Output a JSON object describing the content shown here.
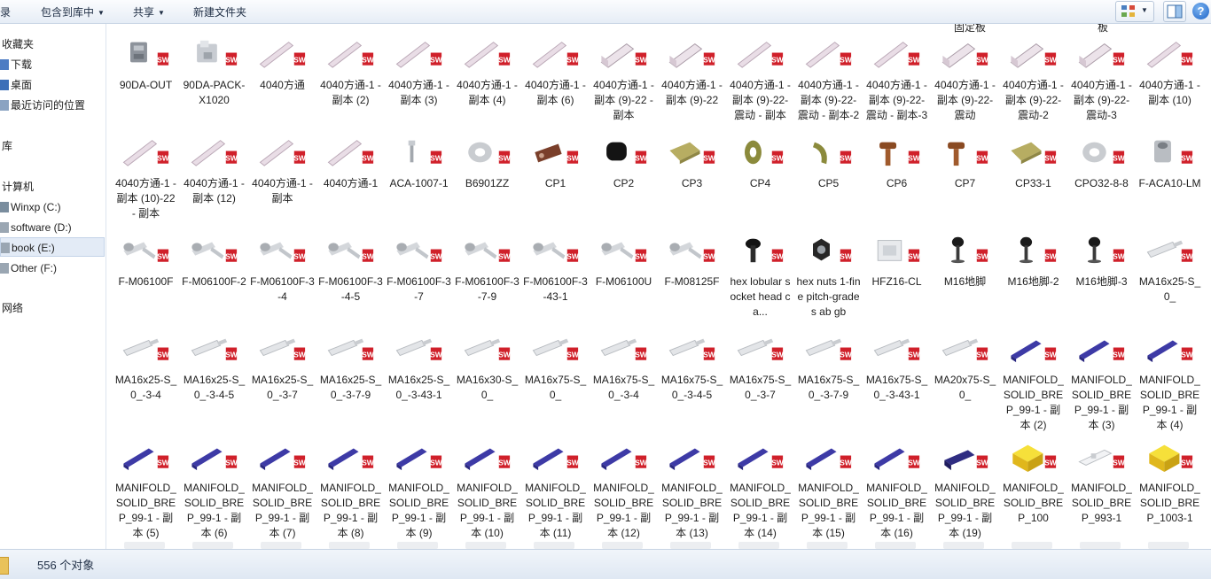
{
  "toolbar": {
    "partial_left": "录",
    "include_library": "包含到库中",
    "share": "共享",
    "new_folder": "新建文件夹"
  },
  "sidebar": {
    "favorites": "收藏夹",
    "downloads": "下载",
    "desktop": "桌面",
    "recent": "最近访问的位置",
    "libraries": "库",
    "computer": "计算机",
    "drive_c": "Winxp (C:)",
    "drive_d": "software (D:)",
    "drive_e": "book (E:)",
    "drive_f": "Other (F:)",
    "network": "网络"
  },
  "partial_top_labels": [
    "固定板",
    "板"
  ],
  "rows": [
    [
      {
        "name": "90DA-OUT",
        "icon": "connector-gray"
      },
      {
        "name": "90DA-PACK-X1020",
        "icon": "connector-light"
      },
      {
        "name": "4040方通",
        "icon": "profile-rod"
      },
      {
        "name": "4040方通-1 - 副本 (2)",
        "icon": "profile-rod"
      },
      {
        "name": "4040方通-1 - 副本 (3)",
        "icon": "profile-rod"
      },
      {
        "name": "4040方通-1 - 副本 (4)",
        "icon": "profile-rod"
      },
      {
        "name": "4040方通-1 - 副本 (6)",
        "icon": "profile-rod"
      },
      {
        "name": "4040方通-1 - 副本 (9)-22 - 副本",
        "icon": "profile-short"
      },
      {
        "name": "4040方通-1 - 副本 (9)-22",
        "icon": "profile-short"
      },
      {
        "name": "4040方通-1 - 副本 (9)-22-震动 - 副本",
        "icon": "profile-rod"
      },
      {
        "name": "4040方通-1 - 副本 (9)-22-震动 - 副本-2",
        "icon": "profile-rod"
      },
      {
        "name": "4040方通-1 - 副本 (9)-22-震动 - 副本-3",
        "icon": "profile-rod"
      },
      {
        "name": "4040方通-1 - 副本 (9)-22-震动",
        "icon": "profile-short"
      },
      {
        "name": "4040方通-1 - 副本 (9)-22-震动-2",
        "icon": "profile-short"
      },
      {
        "name": "4040方通-1 - 副本 (9)-22-震动-3",
        "icon": "profile-short"
      },
      {
        "name": "4040方通-1 - 副本 (10)",
        "icon": "profile-rod"
      }
    ],
    [
      {
        "name": "4040方通-1 - 副本 (10)-22 - 副本",
        "icon": "profile-rod"
      },
      {
        "name": "4040方通-1 - 副本 (12)",
        "icon": "profile-rod"
      },
      {
        "name": "4040方通-1 - 副本",
        "icon": "profile-rod"
      },
      {
        "name": "4040方通-1",
        "icon": "profile-rod"
      },
      {
        "name": "ACA-1007-1",
        "icon": "pin-small"
      },
      {
        "name": "B6901ZZ",
        "icon": "bearing"
      },
      {
        "name": "CP1",
        "icon": "clamp-brown"
      },
      {
        "name": "CP2",
        "icon": "block-black"
      },
      {
        "name": "CP3",
        "icon": "plate-khaki"
      },
      {
        "name": "CP4",
        "icon": "washer-olive"
      },
      {
        "name": "CP5",
        "icon": "hook-olive"
      },
      {
        "name": "CP6",
        "icon": "bolt-brown"
      },
      {
        "name": "CP7",
        "icon": "bolt-brown"
      },
      {
        "name": "CP33-1",
        "icon": "plate-khaki"
      },
      {
        "name": "CPO32-8-8",
        "icon": "bearing"
      },
      {
        "name": "F-ACA10-LM",
        "icon": "nut-gray"
      }
    ],
    [
      {
        "name": "F-M06100F",
        "icon": "screw-assembly"
      },
      {
        "name": "F-M06100F-2",
        "icon": "screw-assembly"
      },
      {
        "name": "F-M06100F-3-4",
        "icon": "screw-assembly"
      },
      {
        "name": "F-M06100F-3-4-5",
        "icon": "screw-assembly"
      },
      {
        "name": "F-M06100F-3-7",
        "icon": "screw-assembly"
      },
      {
        "name": "F-M06100F-3-7-9",
        "icon": "screw-assembly"
      },
      {
        "name": "F-M06100F-3-43-1",
        "icon": "screw-assembly"
      },
      {
        "name": "F-M06100U",
        "icon": "screw-assembly"
      },
      {
        "name": "F-M08125F",
        "icon": "screw-assembly"
      },
      {
        "name": "hex lobular socket head ca...",
        "icon": "bolt-black"
      },
      {
        "name": "hex nuts 1-fine pitch-grades ab gb",
        "icon": "hexnut-black"
      },
      {
        "name": "HFZ16-CL",
        "icon": "frame-light"
      },
      {
        "name": "M16地脚",
        "icon": "foot-black"
      },
      {
        "name": "M16地脚-2",
        "icon": "foot-black"
      },
      {
        "name": "M16地脚-3",
        "icon": "foot-black"
      },
      {
        "name": "MA16x25-S_0_",
        "icon": "cylinder-rod"
      }
    ],
    [
      {
        "name": "MA16x25-S_0_-3-4",
        "icon": "cylinder-rod"
      },
      {
        "name": "MA16x25-S_0_-3-4-5",
        "icon": "cylinder-rod"
      },
      {
        "name": "MA16x25-S_0_-3-7",
        "icon": "cylinder-rod"
      },
      {
        "name": "MA16x25-S_0_-3-7-9",
        "icon": "cylinder-rod"
      },
      {
        "name": "MA16x25-S_0_-3-43-1",
        "icon": "cylinder-rod"
      },
      {
        "name": "MA16x30-S_0_",
        "icon": "cylinder-rod"
      },
      {
        "name": "MA16x75-S_0_",
        "icon": "cylinder-rod"
      },
      {
        "name": "MA16x75-S_0_-3-4",
        "icon": "cylinder-rod"
      },
      {
        "name": "MA16x75-S_0_-3-4-5",
        "icon": "cylinder-rod"
      },
      {
        "name": "MA16x75-S_0_-3-7",
        "icon": "cylinder-rod"
      },
      {
        "name": "MA16x75-S_0_-3-7-9",
        "icon": "cylinder-rod"
      },
      {
        "name": "MA16x75-S_0_-3-43-1",
        "icon": "cylinder-rod"
      },
      {
        "name": "MA20x75-S_0_",
        "icon": "cylinder-rod"
      },
      {
        "name": "MANIFOLD_SOLID_BREP_99-1 - 副本 (2)",
        "icon": "manifold-blue"
      },
      {
        "name": "MANIFOLD_SOLID_BREP_99-1 - 副本 (3)",
        "icon": "manifold-blue"
      },
      {
        "name": "MANIFOLD_SOLID_BREP_99-1 - 副本 (4)",
        "icon": "manifold-blue"
      }
    ],
    [
      {
        "name": "MANIFOLD_SOLID_BREP_99-1 - 副本 (5)",
        "icon": "manifold-blue"
      },
      {
        "name": "MANIFOLD_SOLID_BREP_99-1 - 副本 (6)",
        "icon": "manifold-blue"
      },
      {
        "name": "MANIFOLD_SOLID_BREP_99-1 - 副本 (7)",
        "icon": "manifold-blue"
      },
      {
        "name": "MANIFOLD_SOLID_BREP_99-1 - 副本 (8)",
        "icon": "manifold-blue"
      },
      {
        "name": "MANIFOLD_SOLID_BREP_99-1 - 副本 (9)",
        "icon": "manifold-blue"
      },
      {
        "name": "MANIFOLD_SOLID_BREP_99-1 - 副本 (10)",
        "icon": "manifold-blue"
      },
      {
        "name": "MANIFOLD_SOLID_BREP_99-1 - 副本 (11)",
        "icon": "manifold-blue"
      },
      {
        "name": "MANIFOLD_SOLID_BREP_99-1 - 副本 (12)",
        "icon": "manifold-blue"
      },
      {
        "name": "MANIFOLD_SOLID_BREP_99-1 - 副本 (13)",
        "icon": "manifold-blue"
      },
      {
        "name": "MANIFOLD_SOLID_BREP_99-1 - 副本 (14)",
        "icon": "manifold-blue"
      },
      {
        "name": "MANIFOLD_SOLID_BREP_99-1 - 副本 (15)",
        "icon": "manifold-blue"
      },
      {
        "name": "MANIFOLD_SOLID_BREP_99-1 - 副本 (16)",
        "icon": "manifold-blue"
      },
      {
        "name": "MANIFOLD_SOLID_BREP_99-1 - 副本 (19)",
        "icon": "manifold-dark"
      },
      {
        "name": "MANIFOLD_SOLID_BREP_100",
        "icon": "block-yellow"
      },
      {
        "name": "MANIFOLD_SOLID_BREP_993-1",
        "icon": "rail-white"
      },
      {
        "name": "MANIFOLD_SOLID_BREP_1003-1",
        "icon": "block-yellow"
      }
    ]
  ],
  "status": {
    "count_text": "556 个对象"
  },
  "colors": {
    "sw_badge": "#d0202a",
    "accent": "#1b62c7"
  }
}
